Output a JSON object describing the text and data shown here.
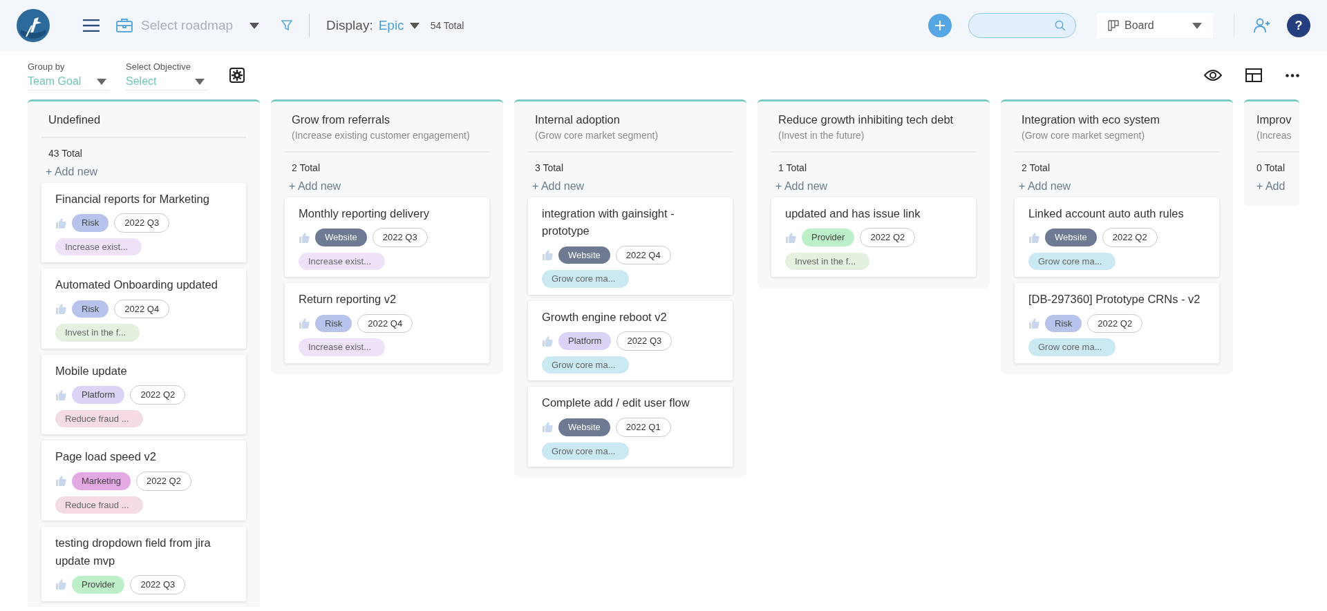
{
  "topbar": {
    "roadmap_placeholder": "Select roadmap",
    "display_label": "Display:",
    "display_value": "Epic",
    "total": "54 Total",
    "view": "Board",
    "help_label": "?"
  },
  "toolbar": {
    "group_by": {
      "label": "Group by",
      "value": "Team Goal"
    },
    "objective": {
      "label": "Select Objective",
      "value": "Select"
    }
  },
  "columns": [
    {
      "title": "Undefined",
      "total": "43 Total",
      "add_label": "+ Add new",
      "cards": [
        {
          "title": "Financial reports for Marketing",
          "type_tag": {
            "label": "Risk",
            "color": "#b7c3ea"
          },
          "quarter": "2022 Q3",
          "goal_tag": {
            "label": "Increase exist...",
            "color": "#ede2f8"
          }
        },
        {
          "title": "Automated Onboarding updated",
          "type_tag": {
            "label": "Risk",
            "color": "#b7c3ea"
          },
          "quarter": "2022 Q4",
          "goal_tag": {
            "label": "Invest in the f...",
            "color": "#e4f1e1"
          }
        },
        {
          "title": "Mobile update",
          "type_tag": {
            "label": "Platform",
            "color": "#ddd3f6"
          },
          "quarter": "2022 Q2",
          "goal_tag": {
            "label": "Reduce fraud ...",
            "color": "#f5dbe2"
          }
        },
        {
          "title": "Page load speed v2",
          "type_tag": {
            "label": "Marketing",
            "color": "#e2a9e2"
          },
          "quarter": "2022 Q2",
          "goal_tag": {
            "label": "Reduce fraud ...",
            "color": "#f5dbe2"
          }
        },
        {
          "title": "testing dropdown field from jira update mvp",
          "type_tag": {
            "label": "Provider",
            "color": "#bdf0c9"
          },
          "quarter": "2022 Q3"
        }
      ]
    },
    {
      "title": "Grow from referrals",
      "subtitle": "(Increase existing customer engagement)",
      "total": "2 Total",
      "add_label": "+ Add new",
      "cards": [
        {
          "title": "Monthly reporting delivery",
          "type_tag": {
            "label": "Website",
            "color": "#6d7a91"
          },
          "quarter": "2022 Q3",
          "goal_tag": {
            "label": "Increase exist...",
            "color": "#ede2f8"
          }
        },
        {
          "title": "Return reporting v2",
          "type_tag": {
            "label": "Risk",
            "color": "#b7c3ea"
          },
          "quarter": "2022 Q4",
          "goal_tag": {
            "label": "Increase exist...",
            "color": "#ede2f8"
          }
        }
      ]
    },
    {
      "title": "Internal adoption",
      "subtitle": "(Grow core market segment)",
      "total": "3 Total",
      "add_label": "+ Add new",
      "cards": [
        {
          "title": "integration with gainsight - prototype",
          "type_tag": {
            "label": "Website",
            "color": "#6d7a91"
          },
          "quarter": "2022 Q4",
          "goal_tag": {
            "label": "Grow core ma...",
            "color": "#cae9f3"
          }
        },
        {
          "title": "Growth engine reboot v2",
          "type_tag": {
            "label": "Platform",
            "color": "#ddd3f6"
          },
          "quarter": "2022 Q3",
          "goal_tag": {
            "label": "Grow core ma...",
            "color": "#cae9f3"
          }
        },
        {
          "title": "Complete add / edit user flow",
          "type_tag": {
            "label": "Website",
            "color": "#6d7a91"
          },
          "quarter": "2022 Q1",
          "goal_tag": {
            "label": "Grow core ma...",
            "color": "#cae9f3"
          }
        }
      ]
    },
    {
      "title": "Reduce growth inhibiting tech debt",
      "subtitle": "(Invest in the future)",
      "total": "1 Total",
      "add_label": "+ Add new",
      "cards": [
        {
          "title": "updated and has issue link",
          "type_tag": {
            "label": "Provider",
            "color": "#bdf0c9"
          },
          "quarter": "2022 Q2",
          "goal_tag": {
            "label": "Invest in the f...",
            "color": "#e4f1e1"
          }
        }
      ]
    },
    {
      "title": "Integration with eco system",
      "subtitle": "(Grow core market segment)",
      "total": "2 Total",
      "add_label": "+ Add new",
      "cards": [
        {
          "title": "Linked account auto auth rules",
          "type_tag": {
            "label": "Website",
            "color": "#6d7a91"
          },
          "quarter": "2022 Q2",
          "goal_tag": {
            "label": "Grow core ma...",
            "color": "#cae9f3"
          }
        },
        {
          "title": "[DB-297360] Prototype CRNs - v2",
          "type_tag": {
            "label": "Risk",
            "color": "#b7c3ea"
          },
          "quarter": "2022 Q2",
          "goal_tag": {
            "label": "Grow core ma...",
            "color": "#cae9f3"
          }
        }
      ]
    },
    {
      "title": "Improv",
      "subtitle": "(Increas",
      "total": "0 Total",
      "add_label": "+ Add",
      "partial": true
    }
  ]
}
